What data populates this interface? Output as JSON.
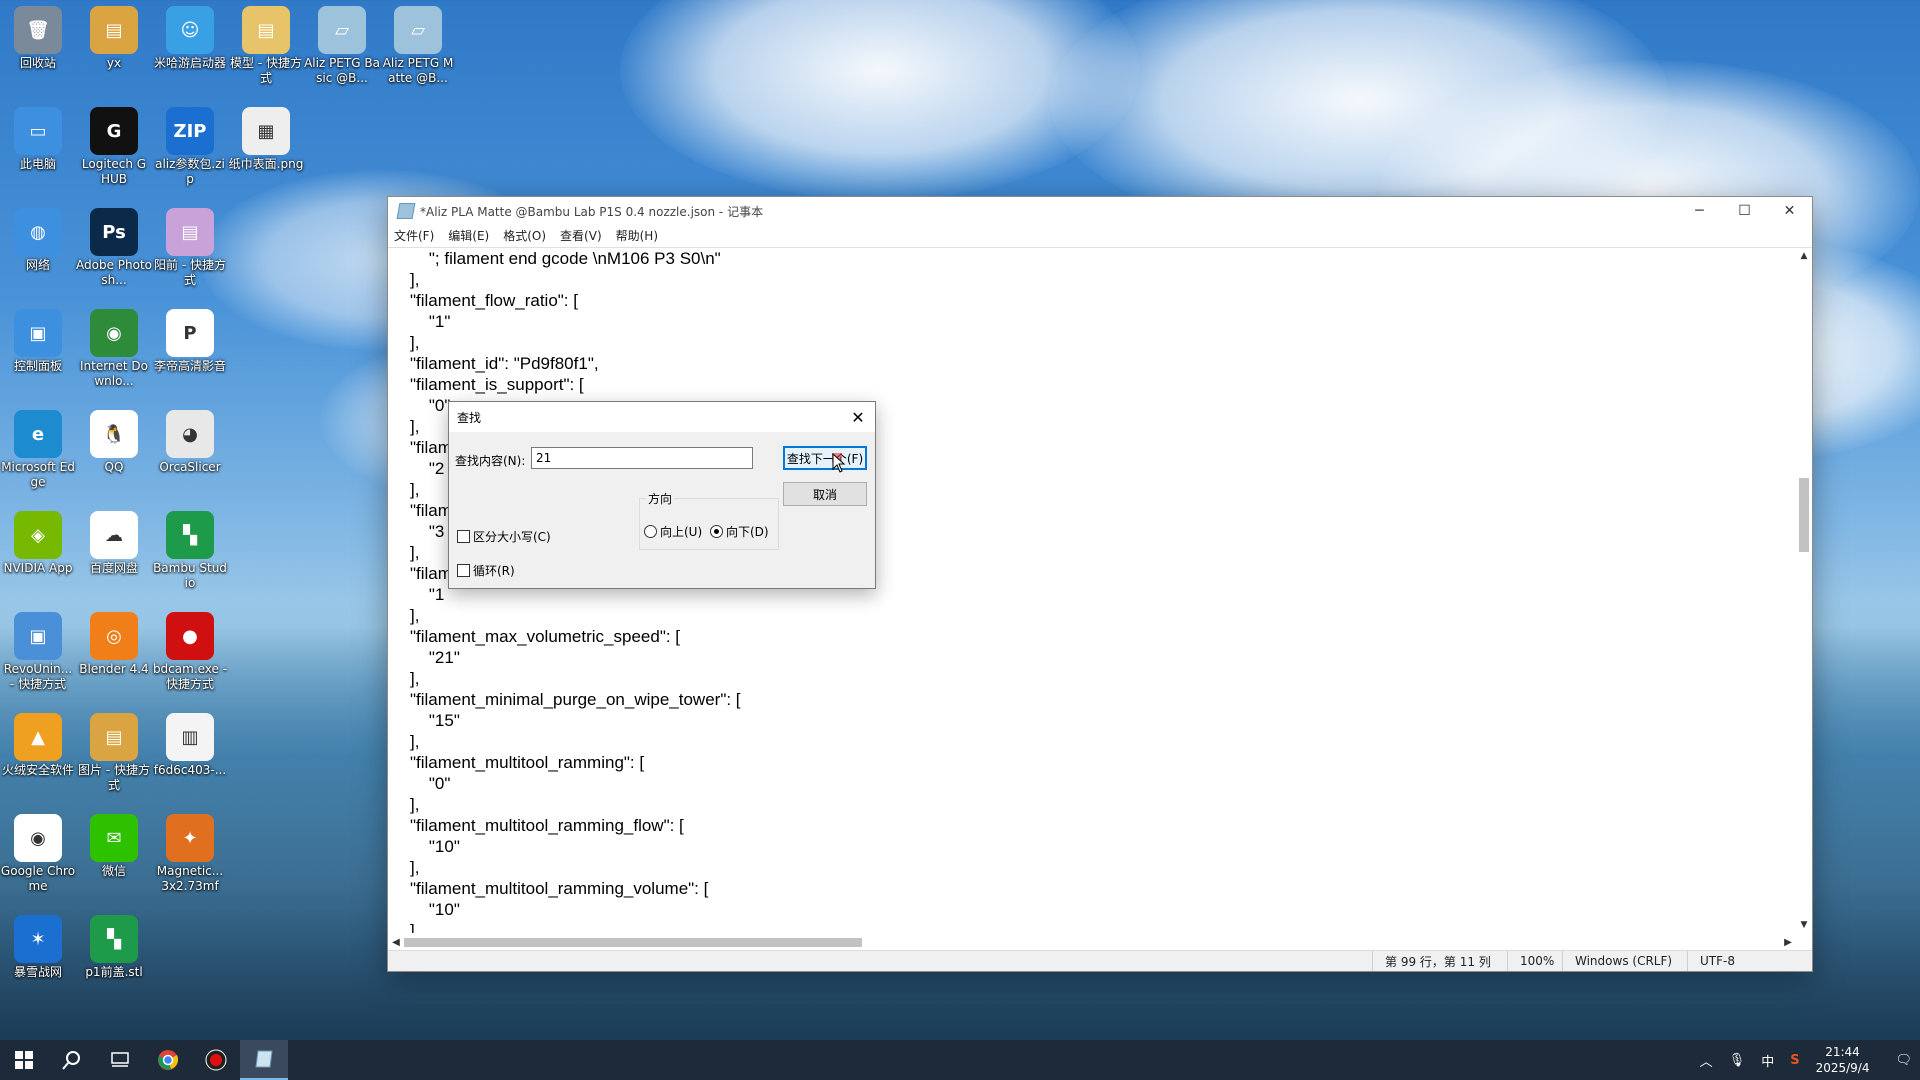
{
  "desktop": {
    "icons": [
      {
        "label": "回收站",
        "color": "#7a8a9a",
        "glyph": "🗑"
      },
      {
        "label": "yx",
        "color": "#d9a441",
        "glyph": "▤"
      },
      {
        "label": "米哈游启动器",
        "color": "#3aa0e6",
        "glyph": "☺"
      },
      {
        "label": "模型 - 快捷方式",
        "color": "#e7c36a",
        "glyph": "▤"
      },
      {
        "label": "Aliz PETG Basic @B...",
        "color": "#9cc2dc",
        "glyph": "▱"
      },
      {
        "label": "Aliz PETG Matte @B...",
        "color": "#9cc2dc",
        "glyph": "▱"
      },
      {
        "label": "此电脑",
        "color": "#3d8fe0",
        "glyph": "▭"
      },
      {
        "label": "Logitech G HUB",
        "color": "#111111",
        "glyph": "G"
      },
      {
        "label": "aliz参数包.zip",
        "color": "#1a6fd1",
        "glyph": "ZIP"
      },
      {
        "label": "纸巾表面.png",
        "color": "#eeeeee",
        "glyph": "▦"
      },
      {
        "label": "网络",
        "color": "#3d8fe0",
        "glyph": "◍"
      },
      {
        "label": "Adobe Photosh...",
        "color": "#0b2a4a",
        "glyph": "Ps"
      },
      {
        "label": "阳前 - 快捷方式",
        "color": "#c8a2d8",
        "glyph": "▤"
      },
      {
        "label": "控制面板",
        "color": "#3d8fe0",
        "glyph": "▣"
      },
      {
        "label": "Internet Downlo...",
        "color": "#2e8b3a",
        "glyph": "◉"
      },
      {
        "label": "李帝高清影音",
        "color": "#ffffff",
        "glyph": "P"
      },
      {
        "label": "Microsoft Edge",
        "color": "#1c8bd0",
        "glyph": "e"
      },
      {
        "label": "QQ",
        "color": "#ffffff",
        "glyph": "🐧"
      },
      {
        "label": "OrcaSlicer",
        "color": "#e8e8e8",
        "glyph": "◕"
      },
      {
        "label": "NVIDIA App",
        "color": "#76b900",
        "glyph": "◈"
      },
      {
        "label": "百度网盘",
        "color": "#ffffff",
        "glyph": "☁"
      },
      {
        "label": "Bambu Studio",
        "color": "#1d9a4a",
        "glyph": "▚"
      },
      {
        "label": "RevoUnin... - 快捷方式",
        "color": "#4a90d9",
        "glyph": "▣"
      },
      {
        "label": "Blender 4.4",
        "color": "#f07f1a",
        "glyph": "◎"
      },
      {
        "label": "bdcam.exe - 快捷方式",
        "color": "#d01010",
        "glyph": "●"
      },
      {
        "label": "火绒安全软件",
        "color": "#f0a020",
        "glyph": "▲"
      },
      {
        "label": "图片 - 快捷方式",
        "color": "#d9a441",
        "glyph": "▤"
      },
      {
        "label": "f6d6c403-...",
        "color": "#f4f4f4",
        "glyph": "▥"
      },
      {
        "label": "Google Chrome",
        "color": "#ffffff",
        "glyph": "◉"
      },
      {
        "label": "微信",
        "color": "#2dc100",
        "glyph": "✉"
      },
      {
        "label": "Magnetic... 3x2.73mf",
        "color": "#e07020",
        "glyph": "✦"
      },
      {
        "label": "暴雪战网",
        "color": "#1a6fd1",
        "glyph": "✶"
      },
      {
        "label": "p1前盖.stl",
        "color": "#1d9a4a",
        "glyph": "▚"
      }
    ]
  },
  "notepad": {
    "title": "*Aliz PLA Matte @Bambu Lab P1S 0.4 nozzle.json - 记事本",
    "controls": {
      "minimize": "─",
      "maximize": "☐",
      "close": "✕"
    },
    "menu": [
      "文件(F)",
      "编辑(E)",
      "格式(O)",
      "查看(V)",
      "帮助(H)"
    ],
    "lines": [
      "    \"; filament end gcode \\nM106 P3 S0\\n\"",
      "],",
      "\"filament_flow_ratio\": [",
      "    \"1\"",
      "],",
      "\"filament_id\": \"Pd9f80f1\",",
      "\"filament_is_support\": [",
      "    \"0\"",
      "],",
      "\"filam",
      "    \"2",
      "],",
      "\"filam",
      "    \"3",
      "],",
      "\"filam",
      "    \"1",
      "],",
      "\"filament_max_volumetric_speed\": [",
      "    \"21\"",
      "],",
      "\"filament_minimal_purge_on_wipe_tower\": [",
      "    \"15\"",
      "],",
      "\"filament_multitool_ramming\": [",
      "    \"0\"",
      "],",
      "\"filament_multitool_ramming_flow\": [",
      "    \"10\"",
      "],",
      "\"filament_multitool_ramming_volume\": [",
      "    \"10\"",
      "],"
    ],
    "status": {
      "position": "第 99 行，第 11 列",
      "zoom": "100%",
      "line_ending": "Windows (CRLF)",
      "encoding": "UTF-8"
    }
  },
  "find_dialog": {
    "title": "查找",
    "label": "查找内容(N):",
    "value": "21",
    "find_next": "查找下一个(F)",
    "cancel": "取消",
    "direction_label": "方向",
    "up": "向上(U)",
    "down": "向下(D)",
    "selected_direction": "down",
    "match_case": "区分大小写(C)",
    "wrap": "循环(R)"
  },
  "taskbar": {
    "tray_ime": "中",
    "time": "21:44",
    "date": "2025/9/4"
  }
}
